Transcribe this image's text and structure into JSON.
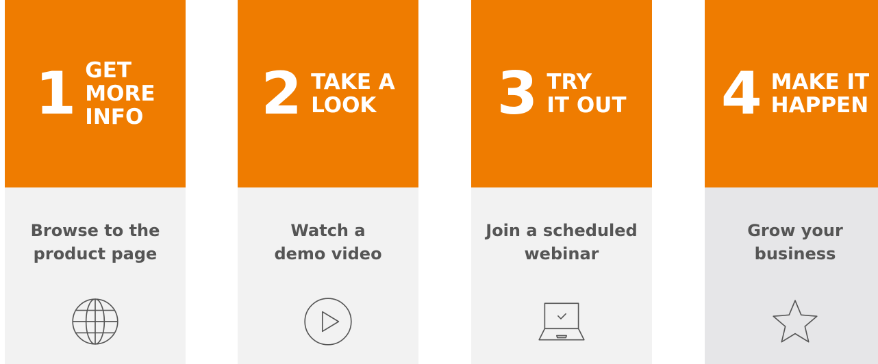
{
  "steps": [
    {
      "number": "1",
      "title": "GET\nMORE\nINFO",
      "description": "Browse to the\nproduct page",
      "icon": "globe-icon"
    },
    {
      "number": "2",
      "title": "TAKE A\nLOOK",
      "description": "Watch a\ndemo video",
      "icon": "play-icon"
    },
    {
      "number": "3",
      "title": "TRY\nIT OUT",
      "description": "Join a scheduled\nwebinar",
      "icon": "laptop-icon"
    },
    {
      "number": "4",
      "title": "MAKE IT\nHAPPEN",
      "description": "Grow your\nbusiness",
      "icon": "star-icon"
    }
  ],
  "colors": {
    "accent": "#ef7c00",
    "card_background": "#f2f2f2",
    "card_background_last": "#e6e6e8",
    "text": "#555555"
  }
}
